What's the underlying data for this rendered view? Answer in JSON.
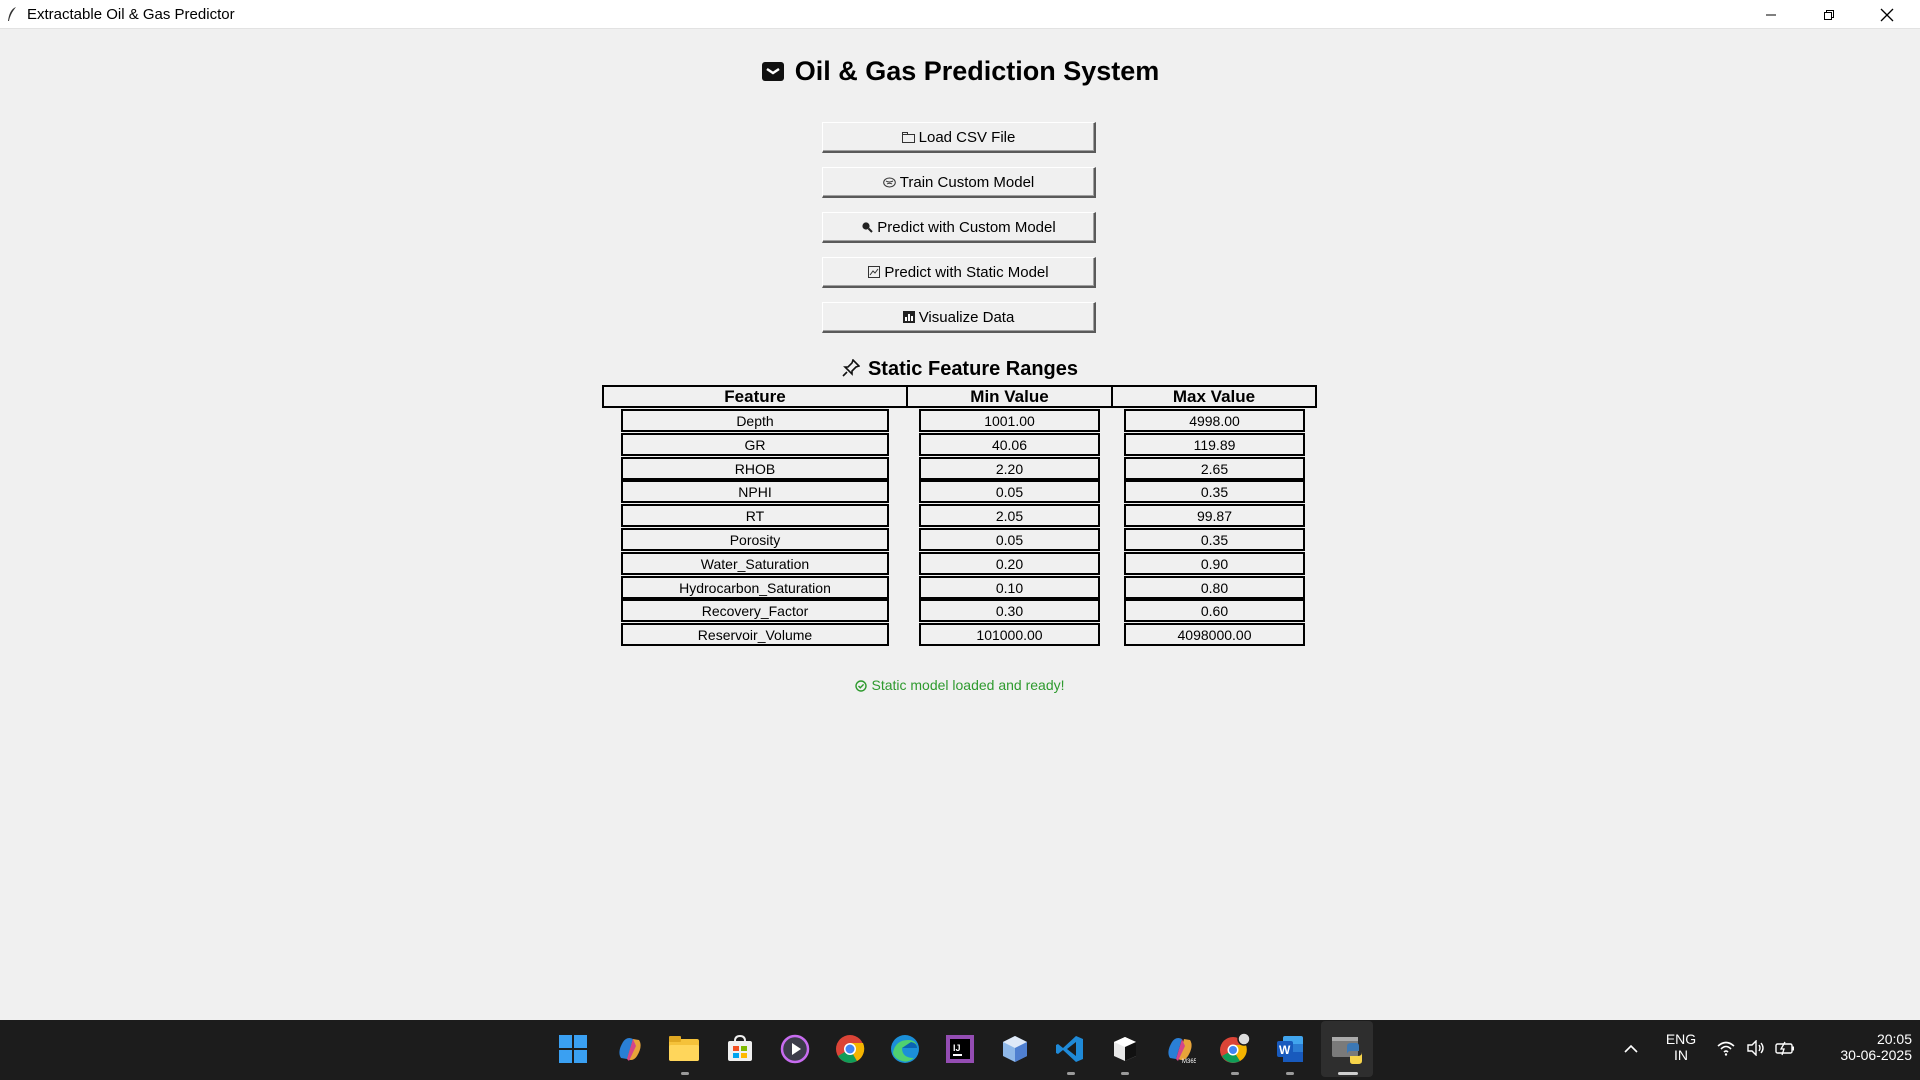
{
  "window": {
    "title": "Extractable Oil & Gas Predictor"
  },
  "app": {
    "heading": "Oil & Gas Prediction System",
    "buttons": [
      {
        "label": "Load CSV File",
        "icon": "folder-icon"
      },
      {
        "label": "Train Custom Model",
        "icon": "brain-icon"
      },
      {
        "label": "Predict with Custom Model",
        "icon": "magnifier-icon"
      },
      {
        "label": "Predict with Static Model",
        "icon": "chart-icon"
      },
      {
        "label": "Visualize Data",
        "icon": "bar-chart-icon"
      }
    ],
    "ranges_title": "Static Feature Ranges",
    "table": {
      "headers": [
        "Feature",
        "Min Value",
        "Max Value"
      ],
      "rows": [
        [
          "Depth",
          "1001.00",
          "4998.00"
        ],
        [
          "GR",
          "40.06",
          "119.89"
        ],
        [
          "RHOB",
          "2.20",
          "2.65"
        ],
        [
          "NPHI",
          "0.05",
          "0.35"
        ],
        [
          "RT",
          "2.05",
          "99.87"
        ],
        [
          "Porosity",
          "0.05",
          "0.35"
        ],
        [
          "Water_Saturation",
          "0.20",
          "0.90"
        ],
        [
          "Hydrocarbon_Saturation",
          "0.10",
          "0.80"
        ],
        [
          "Recovery_Factor",
          "0.30",
          "0.60"
        ],
        [
          "Reservoir_Volume",
          "101000.00",
          "4098000.00"
        ]
      ]
    },
    "status": "Static model loaded and ready!",
    "status_color": "#2e9a2e"
  },
  "taskbar": {
    "apps": [
      "windows-start-icon",
      "copilot-icon",
      "file-explorer-icon",
      "ms-store-icon",
      "media-player-icon",
      "chrome-icon",
      "edge-icon",
      "intellij-icon",
      "box-app-icon",
      "vscode-icon",
      "terminal-icon",
      "m365-icon",
      "chrome-profile-icon",
      "word-icon",
      "python-icon"
    ],
    "lang_top": "ENG",
    "lang_bottom": "IN",
    "time": "20:05",
    "date": "30-06-2025"
  }
}
